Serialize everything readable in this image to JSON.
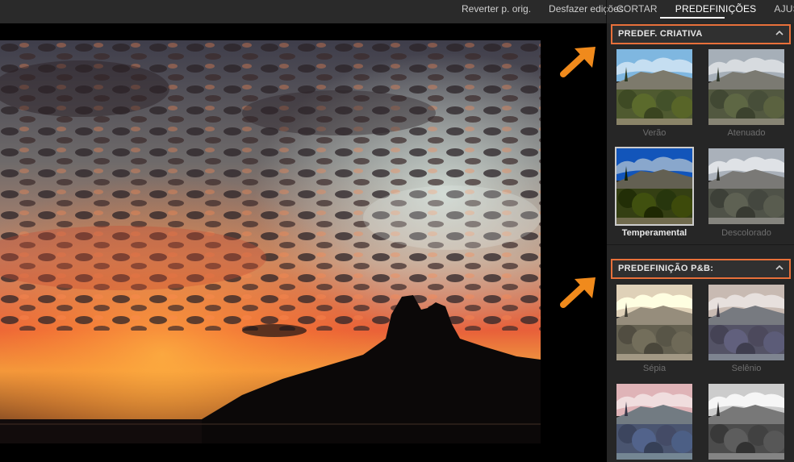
{
  "toolbar": {
    "revert_label": "Reverter p. orig.",
    "undo_label": "Desfazer edições"
  },
  "tabs": [
    {
      "label": "CORTAR",
      "active": false
    },
    {
      "label": "PREDEFINIÇÕES",
      "active": true
    },
    {
      "label": "AJUSTAR",
      "active": false
    }
  ],
  "panel": {
    "creative": {
      "title": "PREDEF. CRIATIVA",
      "presets": [
        {
          "label": "Verão",
          "selected": false
        },
        {
          "label": "Atenuado",
          "selected": false
        },
        {
          "label": "Temperamental",
          "selected": true
        },
        {
          "label": "Descolorado",
          "selected": false
        }
      ]
    },
    "bw": {
      "title": "PREDEFINIÇÃO P&B:",
      "presets": [
        {
          "label": "Sépia",
          "selected": false
        },
        {
          "label": "Selênio",
          "selected": false
        },
        {
          "label": "",
          "selected": false
        },
        {
          "label": "",
          "selected": false
        }
      ]
    }
  },
  "colors": {
    "accent_orange": "#f08a1c",
    "highlight_border": "#e8703a"
  },
  "icons": {
    "collapse": "chevron-up-icon",
    "annotation": "arrow-icon"
  }
}
